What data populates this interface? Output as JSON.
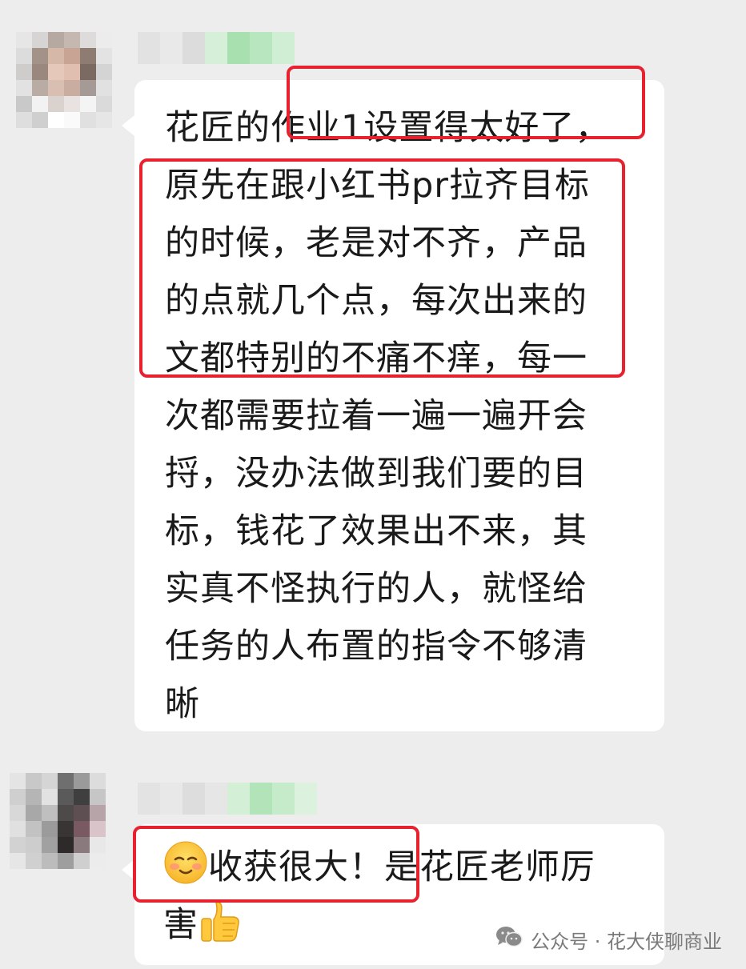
{
  "messages": [
    {
      "lines": [
        "花匠的作业1设置得太好了，",
        "原先在跟小红书pr拉齐目标",
        "的时候，老是对不齐，产品",
        "的点就几个点，每次出来的",
        "文都特别的不痛不痒，每一",
        "次都需要拉着一遍一遍开会",
        "捋，没办法做到我们要的目",
        "标，钱花了效果出不来，其",
        "实真不怪执行的人，就怪给",
        "任务的人布置的指令不够清",
        "晰"
      ]
    },
    {
      "line1_text": "收获很大！是花匠老师厉",
      "line2_text": "害",
      "line1_emoji": "blushing-smile-emoji",
      "line2_emoji": "thumbs-up-emoji"
    }
  ],
  "watermark": {
    "icon": "wechat-icon",
    "text": "公众号 · 花大侠聊商业"
  },
  "colors": {
    "background": "#ededed",
    "bubble": "#ffffff",
    "highlight": "#e8212f",
    "text": "#1a1a1a"
  }
}
